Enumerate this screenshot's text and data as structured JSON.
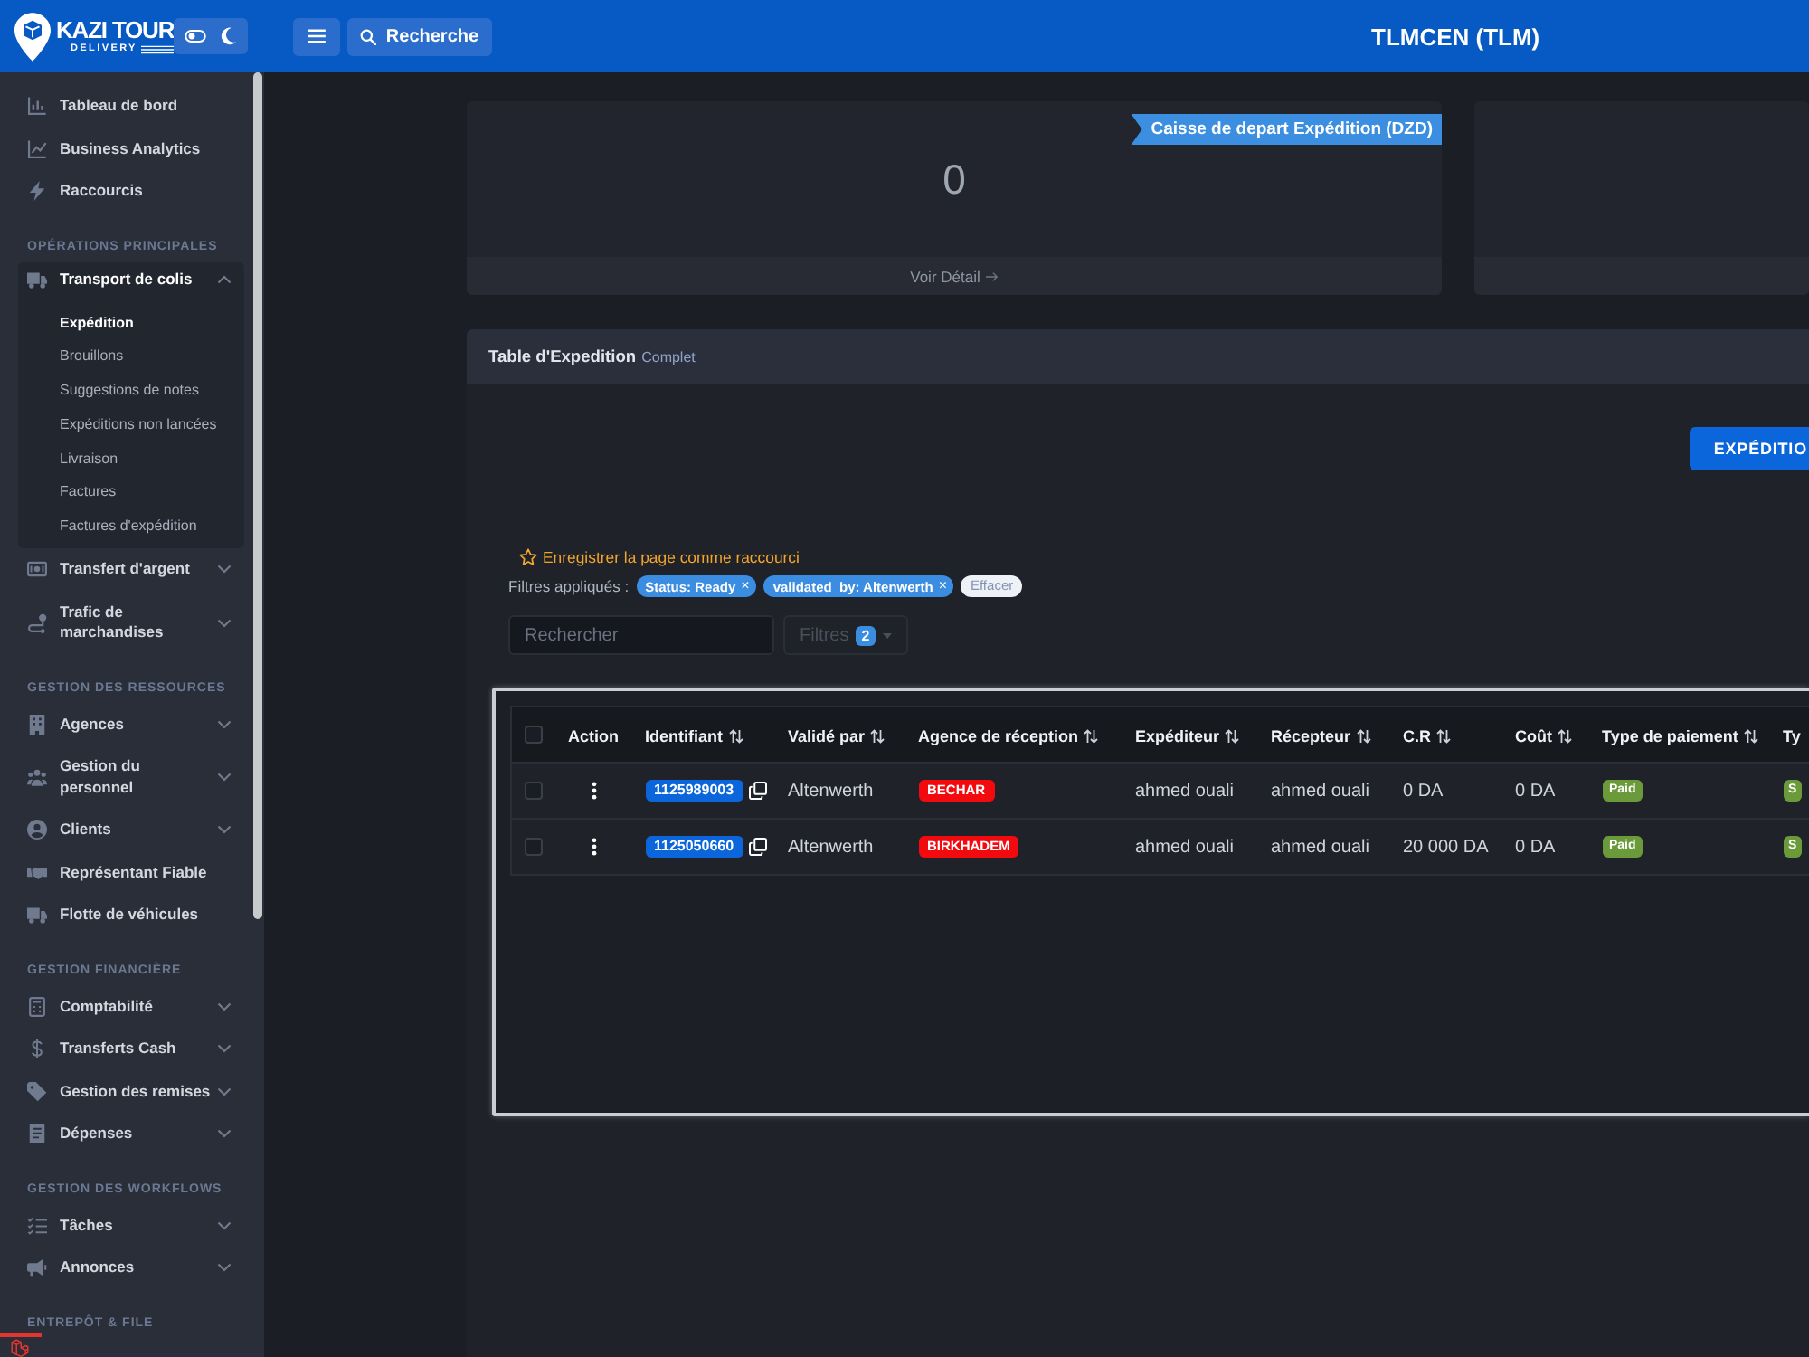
{
  "brand": {
    "name": "KAZI TOUR",
    "tagline": "DELIVERY"
  },
  "topbar": {
    "search_button": "Recherche",
    "title": "TLMCEN (TLM)"
  },
  "sidebar": {
    "top_items": [
      {
        "label": "Tableau de bord",
        "kind": "link"
      },
      {
        "label": "Business Analytics",
        "kind": "link"
      },
      {
        "label": "Raccourcis",
        "kind": "link"
      }
    ],
    "sections": [
      {
        "heading": "OPÉRATIONS PRINCIPALES",
        "items": [
          {
            "label": "Transport de colis",
            "kind": "group",
            "expanded": true,
            "children": [
              {
                "label": "Expédition",
                "selected": true
              },
              {
                "label": "Brouillons",
                "selected": false
              },
              {
                "label": "Suggestions de notes",
                "selected": false
              },
              {
                "label": "Expéditions non lancées",
                "selected": false
              },
              {
                "label": "Livraison",
                "selected": false
              },
              {
                "label": "Factures",
                "selected": false
              },
              {
                "label": "Factures d'expédition",
                "selected": false
              }
            ]
          },
          {
            "label": "Transfert d'argent",
            "kind": "group",
            "expanded": false
          },
          {
            "label": "Trafic de marchandises",
            "kind": "group",
            "expanded": false
          }
        ]
      },
      {
        "heading": "GESTION DES RESSOURCES",
        "items": [
          {
            "label": "Agences",
            "kind": "group",
            "expanded": false
          },
          {
            "label": "Gestion du personnel",
            "kind": "group",
            "expanded": false
          },
          {
            "label": "Clients",
            "kind": "group",
            "expanded": false
          },
          {
            "label": "Représentant Fiable",
            "kind": "link"
          },
          {
            "label": "Flotte de véhicules",
            "kind": "link"
          }
        ]
      },
      {
        "heading": "GESTION FINANCIÈRE",
        "items": [
          {
            "label": "Comptabilité",
            "kind": "group",
            "expanded": false
          },
          {
            "label": "Transferts Cash",
            "kind": "group",
            "expanded": false
          },
          {
            "label": "Gestion des remises",
            "kind": "group",
            "expanded": false
          },
          {
            "label": "Dépenses",
            "kind": "group",
            "expanded": false
          }
        ]
      },
      {
        "heading": "GESTION DES WORKFLOWS",
        "items": [
          {
            "label": "Tâches",
            "kind": "group",
            "expanded": false
          },
          {
            "label": "Annonces",
            "kind": "group",
            "expanded": false
          }
        ]
      },
      {
        "heading": "ENTREPÔT & FILE"
      }
    ]
  },
  "stat_cards": [
    {
      "ribbon": "Caisse de depart Expédition (DZD)",
      "value": "0",
      "link": "Voir Détail"
    }
  ],
  "panel": {
    "title": "Table d'Expedition",
    "subtitle": "Complet",
    "action_button": "EXPÉDITIO",
    "shortcut_link": "Enregistrer la page comme raccourci",
    "filters_label": "Filtres appliqués :",
    "filter_chips": [
      {
        "label": "Status: Ready",
        "remove": "×"
      },
      {
        "label": "validated_by: Altenwerth",
        "remove": "×"
      }
    ],
    "clear_button": "Effacer",
    "search": {
      "placeholder": "Rechercher"
    },
    "filters_button": {
      "label": "Filtres",
      "count": "2",
      "disabled": true
    }
  },
  "table": {
    "select_all": {
      "checked": false
    },
    "columns": [
      {
        "label": "Action",
        "sortable": false
      },
      {
        "label": "Identifiant",
        "sortable": true
      },
      {
        "label": "Validé par",
        "sortable": true
      },
      {
        "label": "Agence de réception",
        "sortable": true
      },
      {
        "label": "Expéditeur",
        "sortable": true
      },
      {
        "label": "Récepteur",
        "sortable": true
      },
      {
        "label": "C.R",
        "sortable": true
      },
      {
        "label": "Coût",
        "sortable": true
      },
      {
        "label": "Type de paiement",
        "sortable": true
      },
      {
        "label": "Ty",
        "sortable": false
      }
    ],
    "rows": [
      {
        "checked": false,
        "id": "1125989003",
        "validated_by": "Altenwerth",
        "agency": "BECHAR",
        "sender": "ahmed ouali",
        "receiver": "ahmed ouali",
        "cr": "0 DA",
        "cost": "0 DA",
        "payment_type": "Paid",
        "column_10": "S"
      },
      {
        "checked": false,
        "id": "1125050660",
        "validated_by": "Altenwerth",
        "agency": "BIRKHADEM",
        "sender": "ahmed ouali",
        "receiver": "ahmed ouali",
        "cr": "20 000 DA",
        "cost": "0 DA",
        "payment_type": "Paid",
        "column_10": "S"
      }
    ]
  }
}
